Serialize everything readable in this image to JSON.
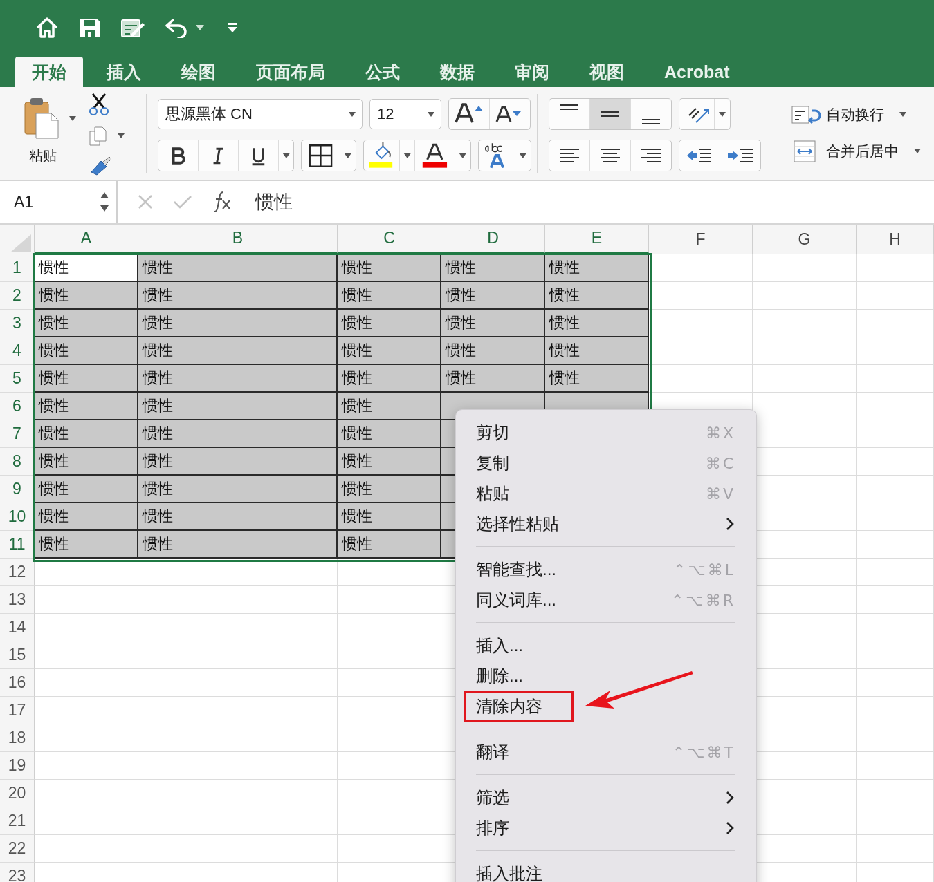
{
  "tabs": [
    {
      "label": "开始",
      "selected": true
    },
    {
      "label": "插入",
      "selected": false
    },
    {
      "label": "绘图",
      "selected": false
    },
    {
      "label": "页面布局",
      "selected": false
    },
    {
      "label": "公式",
      "selected": false
    },
    {
      "label": "数据",
      "selected": false
    },
    {
      "label": "审阅",
      "selected": false
    },
    {
      "label": "视图",
      "selected": false
    },
    {
      "label": "Acrobat",
      "selected": false
    }
  ],
  "ribbon": {
    "paste_label": "粘贴",
    "font_name": "思源黑体 CN",
    "font_size": "12",
    "vertical_align": [
      {
        "kind": "top",
        "selected": false
      },
      {
        "kind": "middle",
        "selected": true
      },
      {
        "kind": "bottom",
        "selected": false
      }
    ],
    "horizontal_align": [
      {
        "kind": "left",
        "selected": false
      },
      {
        "kind": "center",
        "selected": false
      },
      {
        "kind": "right",
        "selected": false
      }
    ],
    "wrap_text": "自动换行",
    "merge_center": "合并后居中"
  },
  "formula_bar": {
    "name_box": "A1",
    "value": "惯性"
  },
  "grid": {
    "columns": [
      {
        "label": "A",
        "selected": true
      },
      {
        "label": "B",
        "selected": true
      },
      {
        "label": "C",
        "selected": true
      },
      {
        "label": "D",
        "selected": true
      },
      {
        "label": "E",
        "selected": true
      },
      {
        "label": "F",
        "selected": false
      },
      {
        "label": "G",
        "selected": false
      },
      {
        "label": "H",
        "selected": false
      }
    ],
    "rows": [
      {
        "header": "1",
        "selected": true,
        "cells": [
          {
            "text": "惯性",
            "active": true
          },
          {
            "text": "惯性",
            "active": false
          },
          {
            "text": "惯性",
            "active": false
          },
          {
            "text": "惯性",
            "active": false
          },
          {
            "text": "惯性",
            "active": false
          }
        ]
      },
      {
        "header": "2",
        "selected": true,
        "cells": [
          {
            "text": "惯性",
            "active": false
          },
          {
            "text": "惯性",
            "active": false
          },
          {
            "text": "惯性",
            "active": false
          },
          {
            "text": "惯性",
            "active": false
          },
          {
            "text": "惯性",
            "active": false
          }
        ]
      },
      {
        "header": "3",
        "selected": true,
        "cells": [
          {
            "text": "惯性",
            "active": false
          },
          {
            "text": "惯性",
            "active": false
          },
          {
            "text": "惯性",
            "active": false
          },
          {
            "text": "惯性",
            "active": false
          },
          {
            "text": "惯性",
            "active": false
          }
        ]
      },
      {
        "header": "4",
        "selected": true,
        "cells": [
          {
            "text": "惯性",
            "active": false
          },
          {
            "text": "惯性",
            "active": false
          },
          {
            "text": "惯性",
            "active": false
          },
          {
            "text": "惯性",
            "active": false
          },
          {
            "text": "惯性",
            "active": false
          }
        ]
      },
      {
        "header": "5",
        "selected": true,
        "cells": [
          {
            "text": "惯性",
            "active": false
          },
          {
            "text": "惯性",
            "active": false
          },
          {
            "text": "惯性",
            "active": false
          },
          {
            "text": "惯性",
            "active": false
          },
          {
            "text": "惯性",
            "active": false
          }
        ]
      },
      {
        "header": "6",
        "selected": true,
        "cells": [
          {
            "text": "惯性",
            "active": false
          },
          {
            "text": "惯性",
            "active": false
          },
          {
            "text": "惯性",
            "active": false
          }
        ]
      },
      {
        "header": "7",
        "selected": true,
        "cells": [
          {
            "text": "惯性",
            "active": false
          },
          {
            "text": "惯性",
            "active": false
          },
          {
            "text": "惯性",
            "active": false
          }
        ]
      },
      {
        "header": "8",
        "selected": true,
        "cells": [
          {
            "text": "惯性",
            "active": false
          },
          {
            "text": "惯性",
            "active": false
          },
          {
            "text": "惯性",
            "active": false
          }
        ]
      },
      {
        "header": "9",
        "selected": true,
        "cells": [
          {
            "text": "惯性",
            "active": false
          },
          {
            "text": "惯性",
            "active": false
          },
          {
            "text": "惯性",
            "active": false
          }
        ]
      },
      {
        "header": "10",
        "selected": true,
        "cells": [
          {
            "text": "惯性",
            "active": false
          },
          {
            "text": "惯性",
            "active": false
          },
          {
            "text": "惯性",
            "active": false
          }
        ]
      },
      {
        "header": "11",
        "selected": true,
        "cells": [
          {
            "text": "惯性",
            "active": false
          },
          {
            "text": "惯性",
            "active": false
          },
          {
            "text": "惯性",
            "active": false
          }
        ]
      },
      {
        "header": "12",
        "selected": false
      },
      {
        "header": "13",
        "selected": false
      },
      {
        "header": "14",
        "selected": false
      },
      {
        "header": "15",
        "selected": false
      },
      {
        "header": "16",
        "selected": false
      },
      {
        "header": "17",
        "selected": false
      },
      {
        "header": "18",
        "selected": false
      },
      {
        "header": "19",
        "selected": false
      },
      {
        "header": "20",
        "selected": false
      },
      {
        "header": "21",
        "selected": false
      },
      {
        "header": "22",
        "selected": false
      },
      {
        "header": "23",
        "selected": false
      }
    ]
  },
  "context_menu": {
    "items": [
      {
        "kind": "item",
        "label": "剪切",
        "shortcut": "⌘X",
        "submenu": false,
        "highlighted": false
      },
      {
        "kind": "item",
        "label": "复制",
        "shortcut": "⌘C",
        "submenu": false,
        "highlighted": false
      },
      {
        "kind": "item",
        "label": "粘贴",
        "shortcut": "⌘V",
        "submenu": false,
        "highlighted": false
      },
      {
        "kind": "item",
        "label": "选择性粘贴",
        "submenu": true,
        "highlighted": false
      },
      {
        "kind": "separator"
      },
      {
        "kind": "item",
        "label": "智能查找...",
        "shortcut": "⌃⌥⌘L",
        "submenu": false,
        "highlighted": false
      },
      {
        "kind": "item",
        "label": "同义词库...",
        "shortcut": "⌃⌥⌘R",
        "submenu": false,
        "highlighted": false
      },
      {
        "kind": "separator"
      },
      {
        "kind": "item",
        "label": "插入...",
        "submenu": false,
        "highlighted": false
      },
      {
        "kind": "item",
        "label": "删除...",
        "submenu": false,
        "highlighted": false
      },
      {
        "kind": "item",
        "label": "清除内容",
        "submenu": false,
        "highlighted": true
      },
      {
        "kind": "separator"
      },
      {
        "kind": "item",
        "label": "翻译",
        "shortcut": "⌃⌥⌘T",
        "submenu": false,
        "highlighted": false
      },
      {
        "kind": "separator"
      },
      {
        "kind": "item",
        "label": "筛选",
        "submenu": true,
        "highlighted": false
      },
      {
        "kind": "item",
        "label": "排序",
        "submenu": true,
        "highlighted": false
      },
      {
        "kind": "separator"
      },
      {
        "kind": "item",
        "label": "插入批注",
        "submenu": false,
        "highlighted": false
      }
    ]
  }
}
